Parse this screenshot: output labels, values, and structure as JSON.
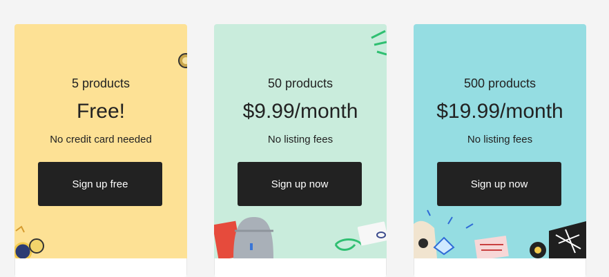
{
  "plans": [
    {
      "products": "5 products",
      "price": "Free!",
      "note": "No credit card needed",
      "cta": "Sign up free",
      "color": "#fde195"
    },
    {
      "products": "50 products",
      "price": "$9.99/month",
      "note": "No listing fees",
      "cta": "Sign up now",
      "color": "#c9ecdc"
    },
    {
      "products": "500 products",
      "price": "$19.99/month",
      "note": "No listing fees",
      "cta": "Sign up now",
      "color": "#95dde2"
    }
  ]
}
